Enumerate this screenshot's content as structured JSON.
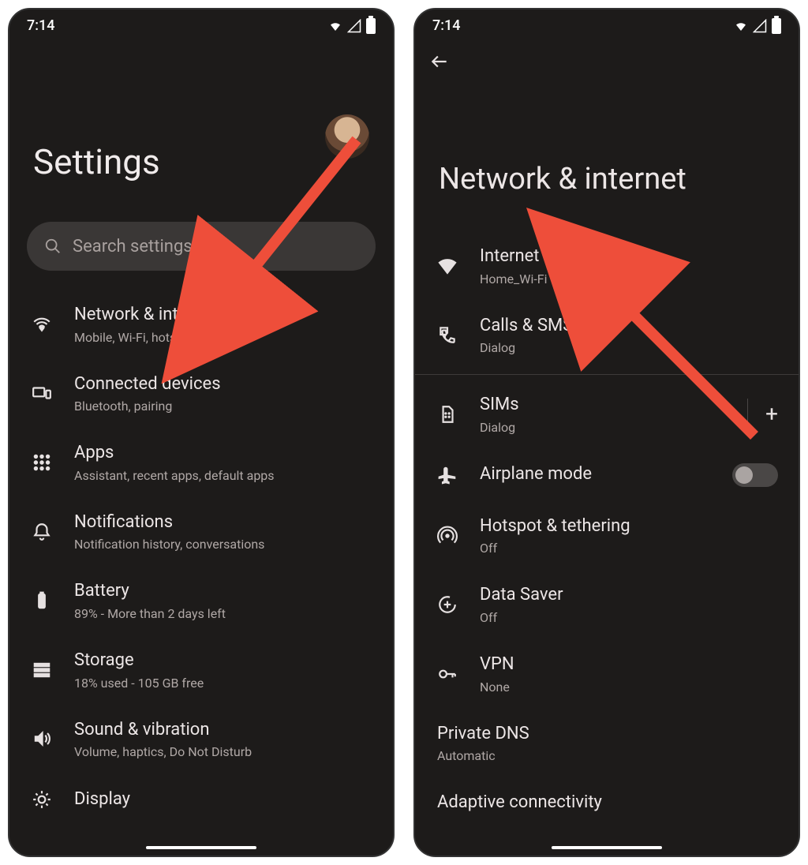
{
  "status": {
    "time": "7:14"
  },
  "screen1": {
    "title": "Settings",
    "search_placeholder": "Search settings",
    "items": [
      {
        "title": "Network & internet",
        "sub": "Mobile, Wi-Fi, hotspot"
      },
      {
        "title": "Connected devices",
        "sub": "Bluetooth, pairing"
      },
      {
        "title": "Apps",
        "sub": "Assistant, recent apps, default apps"
      },
      {
        "title": "Notifications",
        "sub": "Notification history, conversations"
      },
      {
        "title": "Battery",
        "sub": "89% - More than 2 days left"
      },
      {
        "title": "Storage",
        "sub": "18% used - 105 GB free"
      },
      {
        "title": "Sound & vibration",
        "sub": "Volume, haptics, Do Not Disturb"
      },
      {
        "title": "Display",
        "sub": ""
      }
    ]
  },
  "screen2": {
    "title": "Network & internet",
    "items": [
      {
        "title": "Internet",
        "sub": "Home_Wi-Fi"
      },
      {
        "title": "Calls & SMS",
        "sub": "Dialog"
      },
      {
        "title": "SIMs",
        "sub": "Dialog"
      },
      {
        "title": "Airplane mode",
        "sub": ""
      },
      {
        "title": "Hotspot & tethering",
        "sub": "Off"
      },
      {
        "title": "Data Saver",
        "sub": "Off"
      },
      {
        "title": "VPN",
        "sub": "None"
      },
      {
        "title": "Private DNS",
        "sub": "Automatic"
      },
      {
        "title": "Adaptive connectivity",
        "sub": ""
      }
    ]
  }
}
